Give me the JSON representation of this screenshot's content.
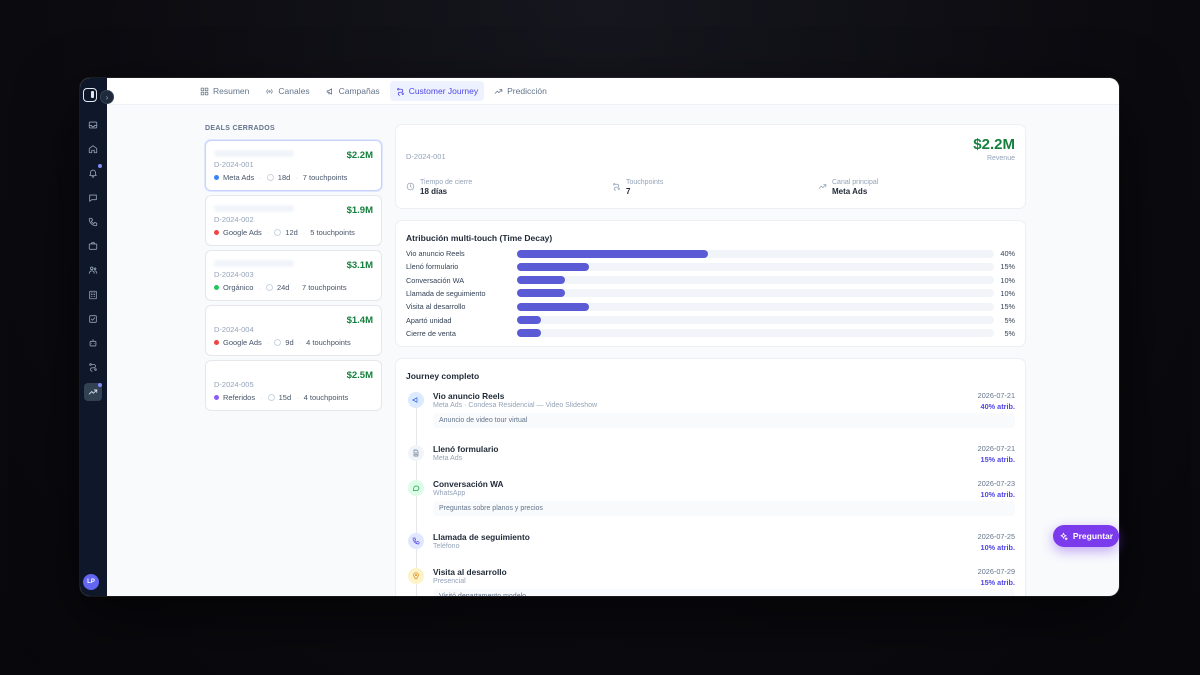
{
  "tabs": [
    {
      "label": "Resumen",
      "icon": "grid-icon"
    },
    {
      "label": "Canales",
      "icon": "radio-icon"
    },
    {
      "label": "Campañas",
      "icon": "megaphone-icon"
    },
    {
      "label": "Customer Journey",
      "icon": "route-icon"
    },
    {
      "label": "Predicción",
      "icon": "trending-up-icon"
    }
  ],
  "active_tab": "Customer Journey",
  "user": {
    "initials": "LP"
  },
  "deals_title": "DEALS CERRADOS",
  "deals": [
    {
      "id": "D-2024-001",
      "amount": "$2.2M",
      "channel": "Meta Ads",
      "channel_color": "#3b82f6",
      "days": "18d",
      "touchpoints": "7 touchpoints"
    },
    {
      "id": "D-2024-002",
      "amount": "$1.9M",
      "channel": "Google Ads",
      "channel_color": "#ef4444",
      "days": "12d",
      "touchpoints": "5 touchpoints"
    },
    {
      "id": "D-2024-003",
      "amount": "$3.1M",
      "channel": "Orgánico",
      "channel_color": "#22c55e",
      "days": "24d",
      "touchpoints": "7 touchpoints"
    },
    {
      "id": "D-2024-004",
      "amount": "$1.4M",
      "channel": "Google Ads",
      "channel_color": "#ef4444",
      "days": "9d",
      "touchpoints": "4 touchpoints"
    },
    {
      "id": "D-2024-005",
      "amount": "$2.5M",
      "channel": "Referidos",
      "channel_color": "#8b5cf6",
      "days": "15d",
      "touchpoints": "4 touchpoints"
    }
  ],
  "summary": {
    "id": "D-2024-001",
    "amount": "$2.2M",
    "revenue_label": "Revenue",
    "stats": [
      {
        "label": "Tiempo de cierre",
        "value": "18 días"
      },
      {
        "label": "Touchpoints",
        "value": "7"
      },
      {
        "label": "Canal principal",
        "value": "Meta Ads"
      }
    ]
  },
  "attribution": {
    "title": "Atribución multi-touch (Time Decay)",
    "rows": [
      {
        "label": "Vio anuncio Reels",
        "pct": "40%",
        "value": 40
      },
      {
        "label": "Llenó formulario",
        "pct": "15%",
        "value": 15
      },
      {
        "label": "Conversación WA",
        "pct": "10%",
        "value": 10
      },
      {
        "label": "Llamada de seguimiento",
        "pct": "10%",
        "value": 10
      },
      {
        "label": "Visita al desarrollo",
        "pct": "15%",
        "value": 15
      },
      {
        "label": "Apartó unidad",
        "pct": "5%",
        "value": 5
      },
      {
        "label": "Cierre de venta",
        "pct": "5%",
        "value": 5
      }
    ]
  },
  "journey": {
    "title": "Journey completo",
    "items": [
      {
        "title": "Vio anuncio Reels",
        "sub": "Meta Ads · Condesa Residencial — Video Slideshow",
        "date": "2026-07-21",
        "attr": "40% atrib.",
        "note": "Anuncio de video tour virtual",
        "icon": "megaphone-icon",
        "bg": "#dbeafe",
        "fg": "#2563eb"
      },
      {
        "title": "Llenó formulario",
        "sub": "Meta Ads",
        "date": "2026-07-21",
        "attr": "15% atrib.",
        "note": "",
        "icon": "file-icon",
        "bg": "#f1f5f9",
        "fg": "#64748b"
      },
      {
        "title": "Conversación WA",
        "sub": "WhatsApp",
        "date": "2026-07-23",
        "attr": "10% atrib.",
        "note": "Preguntas sobre planos y precios",
        "icon": "chat-icon",
        "bg": "#dcfce7",
        "fg": "#16a34a"
      },
      {
        "title": "Llamada de seguimiento",
        "sub": "Teléfono",
        "date": "2026-07-25",
        "attr": "10% atrib.",
        "note": "",
        "icon": "phone-icon",
        "bg": "#e0e7ff",
        "fg": "#4f46e5"
      },
      {
        "title": "Visita al desarrollo",
        "sub": "Presencial",
        "date": "2026-07-29",
        "attr": "15% atrib.",
        "note": "Visitó departamento modelo",
        "icon": "map-pin-icon",
        "bg": "#fef3c7",
        "fg": "#d97706"
      }
    ]
  },
  "ask_button": {
    "label": "Preguntar"
  }
}
